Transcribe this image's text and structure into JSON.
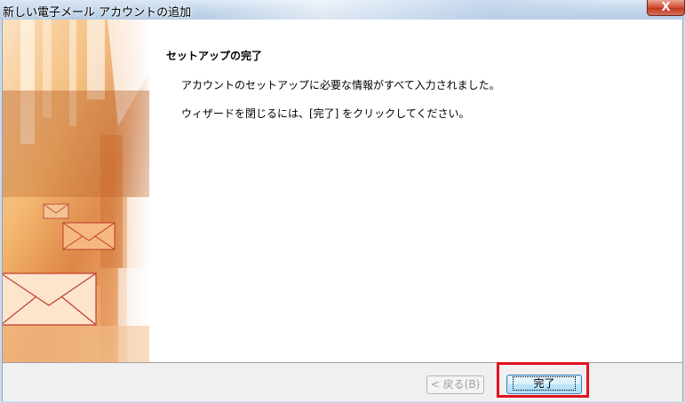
{
  "window": {
    "title": "新しい電子メール アカウントの追加",
    "close_label": "X"
  },
  "content": {
    "heading": "セットアップの完了",
    "message1": "アカウントのセットアップに必要な情報がすべて入力されました。",
    "message2": "ウィザードを閉じるには、[完了] をクリックしてください。"
  },
  "buttons": {
    "back_label": "< 戻る(B)",
    "finish_label": "完了"
  },
  "colors": {
    "highlight": "#e0131d",
    "art_orange": "#e0802a"
  }
}
